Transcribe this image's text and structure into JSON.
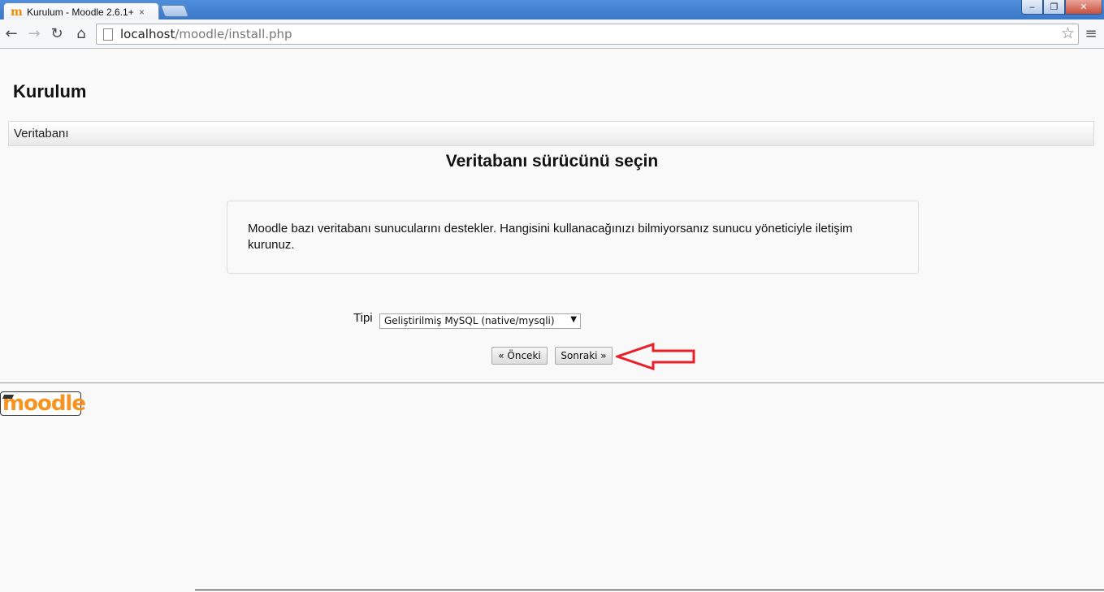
{
  "browser": {
    "tab_title": "Kurulum - Moodle 2.6.1+",
    "tab_close": "×",
    "window_controls": {
      "minimize": "‒",
      "restore": "❐",
      "close": "✕"
    },
    "url_host": "localhost",
    "url_path": "/moodle/install.php",
    "icons": [
      "back-icon",
      "forward-icon",
      "reload-icon",
      "home-icon",
      "page-icon",
      "star-icon",
      "menu-icon"
    ]
  },
  "page": {
    "title": "Kurulum",
    "breadcrumb": "Veritabanı",
    "heading": "Veritabanı sürücünü seçin",
    "info_text": "Moodle bazı veritabanı sunucularını destekler. Hangisini kullanacağınızı bilmiyorsanız sunucu yöneticiyle iletişim kurunuz.",
    "type_label": "Tipi",
    "type_selected": "Geliştirilmiş MySQL (native/mysqli)",
    "prev_button": "« Önceki",
    "next_button": "Sonraki »",
    "logo_text": "moodle"
  },
  "colors": {
    "annotation_arrow": "#e8202a",
    "logo_orange": "#f7931e",
    "titlebar": "#3b78c8"
  }
}
